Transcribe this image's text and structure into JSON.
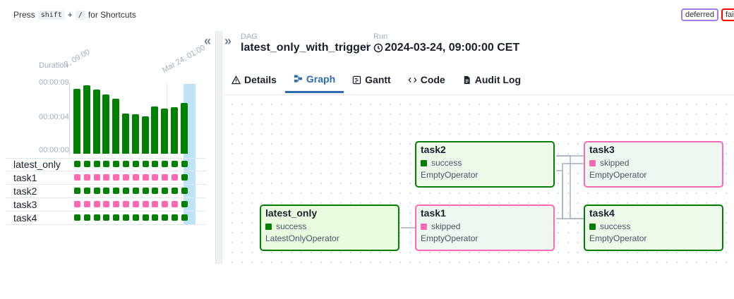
{
  "topbar": {
    "press": "Press",
    "key1": "shift",
    "plus": "+",
    "key2": "/",
    "for_shortcuts": "for Shortcuts",
    "badges": [
      {
        "label": "deferred",
        "color": "#9f7aea"
      },
      {
        "label": "fai",
        "color": "#ff0000"
      }
    ]
  },
  "grid": {
    "duration_label": "Duration",
    "run_labels": [
      "2, 09:00",
      "Mar 24, 01:00"
    ],
    "ticks": [
      "00:00:09",
      "00:00:04",
      "00:00:00"
    ],
    "duration_max_seconds": 9,
    "durations_seconds": [
      8.3,
      8.7,
      8.2,
      7.6,
      7.0,
      5.1,
      5.0,
      4.8,
      6.0,
      5.8,
      5.9,
      6.5
    ],
    "tasks": [
      {
        "name": "latest_only",
        "states": [
          "success",
          "success",
          "success",
          "success",
          "success",
          "success",
          "success",
          "success",
          "success",
          "success",
          "success",
          "success"
        ]
      },
      {
        "name": "task1",
        "states": [
          "skipped",
          "skipped",
          "skipped",
          "skipped",
          "skipped",
          "skipped",
          "skipped",
          "skipped",
          "skipped",
          "skipped",
          "skipped",
          "success"
        ]
      },
      {
        "name": "task2",
        "states": [
          "success",
          "success",
          "success",
          "success",
          "success",
          "success",
          "success",
          "success",
          "success",
          "success",
          "success",
          "success"
        ]
      },
      {
        "name": "task3",
        "states": [
          "skipped",
          "skipped",
          "skipped",
          "skipped",
          "skipped",
          "skipped",
          "skipped",
          "skipped",
          "skipped",
          "skipped",
          "skipped",
          "success"
        ]
      },
      {
        "name": "task4",
        "states": [
          "success",
          "success",
          "success",
          "success",
          "success",
          "success",
          "success",
          "success",
          "success",
          "success",
          "success",
          "success"
        ]
      }
    ]
  },
  "colors": {
    "success": "#008000",
    "skipped": "#ff69b4",
    "accent": "#2b6cb0"
  },
  "header": {
    "dag_caption": "DAG",
    "dag_id": "latest_only_with_trigger",
    "separator": "/",
    "run_caption": "Run",
    "run_id": "2024-03-24, 09:00:00 CET"
  },
  "tabs": [
    {
      "label": "Details",
      "icon": "warning-icon"
    },
    {
      "label": "Graph",
      "icon": "graph-icon",
      "active": true
    },
    {
      "label": "Gantt",
      "icon": "gantt-icon"
    },
    {
      "label": "Code",
      "icon": "code-icon"
    },
    {
      "label": "Audit Log",
      "icon": "document-icon"
    }
  ],
  "graph": {
    "nodes": [
      {
        "title": "task2",
        "state": "success",
        "operator": "EmptyOperator"
      },
      {
        "title": "task3",
        "state": "skipped",
        "operator": "EmptyOperator"
      },
      {
        "title": "latest_only",
        "state": "success",
        "operator": "LatestOnlyOperator"
      },
      {
        "title": "task1",
        "state": "skipped",
        "operator": "EmptyOperator"
      },
      {
        "title": "task4",
        "state": "success",
        "operator": "EmptyOperator"
      }
    ]
  }
}
